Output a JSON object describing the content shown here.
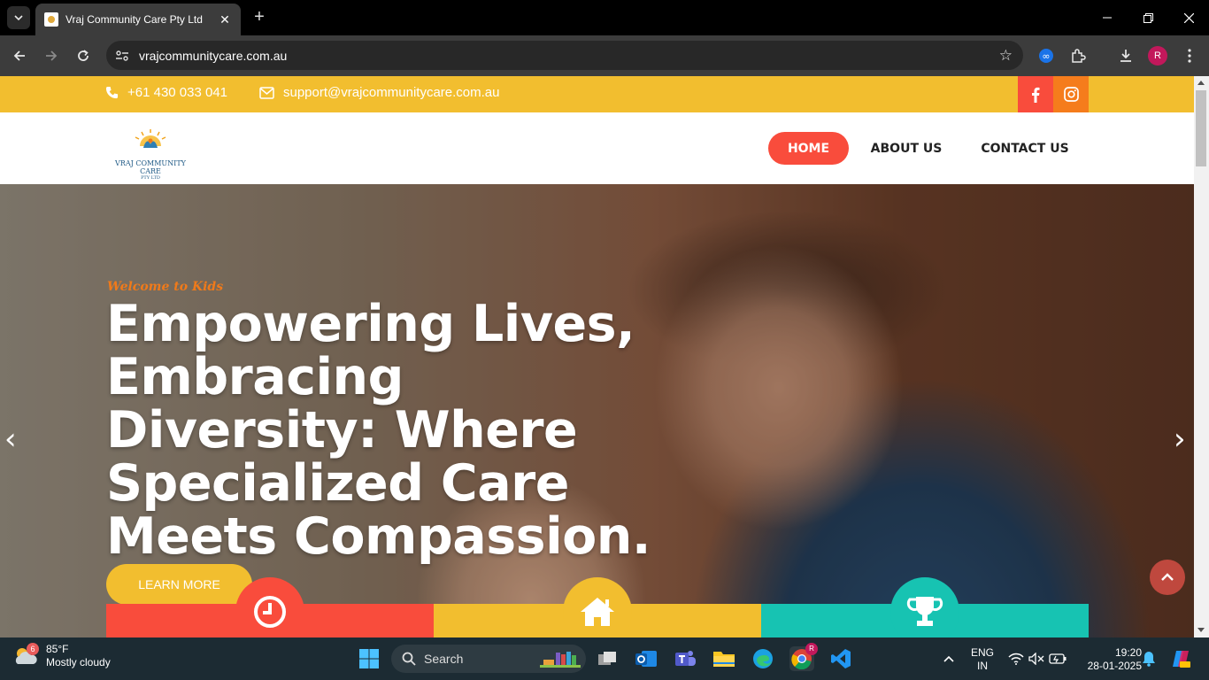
{
  "browser": {
    "tab_title": "Vraj Community Care Pty Ltd",
    "url": "vrajcommunitycare.com.au",
    "profile_initial": "R"
  },
  "site": {
    "topbar": {
      "phone": "+61 430 033 041",
      "email": "support@vrajcommunitycare.com.au",
      "social": [
        "facebook-icon",
        "instagram-icon"
      ],
      "colors": {
        "topbar": "#f2be2f",
        "facebook": "#f94c3c",
        "instagram": "#f57c1c"
      }
    },
    "logo": {
      "name": "VRAJ COMMUNITY CARE",
      "sub": "PTY LTD"
    },
    "nav": {
      "home": "HOME",
      "about": "ABOUT US",
      "contact": "CONTACT US"
    },
    "hero": {
      "tagline": "Welcome to Kids",
      "title": "Empowering Lives, Embracing Diversity: Where Specialized Care Meets Compassion.",
      "button": "LEARN MORE"
    },
    "features": [
      {
        "icon": "clock-icon",
        "color": "#f94c3c"
      },
      {
        "icon": "home-icon",
        "color": "#f2be2f"
      },
      {
        "icon": "trophy-icon",
        "color": "#17c3b2"
      }
    ]
  },
  "taskbar": {
    "weather_temp": "85°F",
    "weather_desc": "Mostly cloudy",
    "weather_badge": "6",
    "search_placeholder": "Search",
    "lang_1": "ENG",
    "lang_2": "IN",
    "time": "19:20",
    "date": "28-01-2025"
  }
}
